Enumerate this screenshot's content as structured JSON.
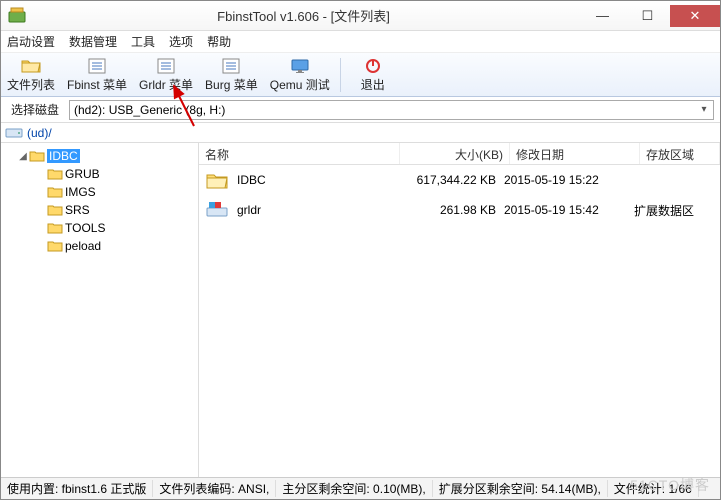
{
  "window": {
    "title": "FbinstTool v1.606 - [文件列表]"
  },
  "menu": {
    "items": [
      "启动设置",
      "数据管理",
      "工具",
      "选项",
      "帮助"
    ]
  },
  "toolbar": {
    "file_list": "文件列表",
    "fbinst_menu": "Fbinst 菜单",
    "grldr_menu": "Grldr 菜单",
    "burg_menu": "Burg 菜单",
    "qemu_test": "Qemu 测试",
    "exit": "退出"
  },
  "disk": {
    "label": "选择磁盘",
    "value": "(hd2): USB_Generic (8g, H:)"
  },
  "crumb": {
    "path": "(ud)/"
  },
  "tree": {
    "root": "IDBC",
    "children": [
      "GRUB",
      "IMGS",
      "SRS",
      "TOOLS",
      "peload"
    ]
  },
  "list": {
    "headers": {
      "name": "名称",
      "size": "大小(KB)",
      "date": "修改日期",
      "area": "存放区域"
    },
    "rows": [
      {
        "name": "IDBC",
        "size": "617,344.22 KB",
        "date": "2015-05-19 15:22",
        "area": "",
        "kind": "folder"
      },
      {
        "name": "grldr",
        "size": "261.98 KB",
        "date": "2015-05-19 15:42",
        "area": "扩展数据区",
        "kind": "file"
      }
    ]
  },
  "status": {
    "left": "使用内置: fbinst1.6 正式版",
    "encoding": "文件列表编码: ANSI,",
    "main_free": "主分区剩余空间:  0.10(MB),",
    "ext_free": "扩展分区剩余空间:  54.14(MB),",
    "count": "文件统计: 1/66"
  },
  "watermark": "51CTO博客"
}
